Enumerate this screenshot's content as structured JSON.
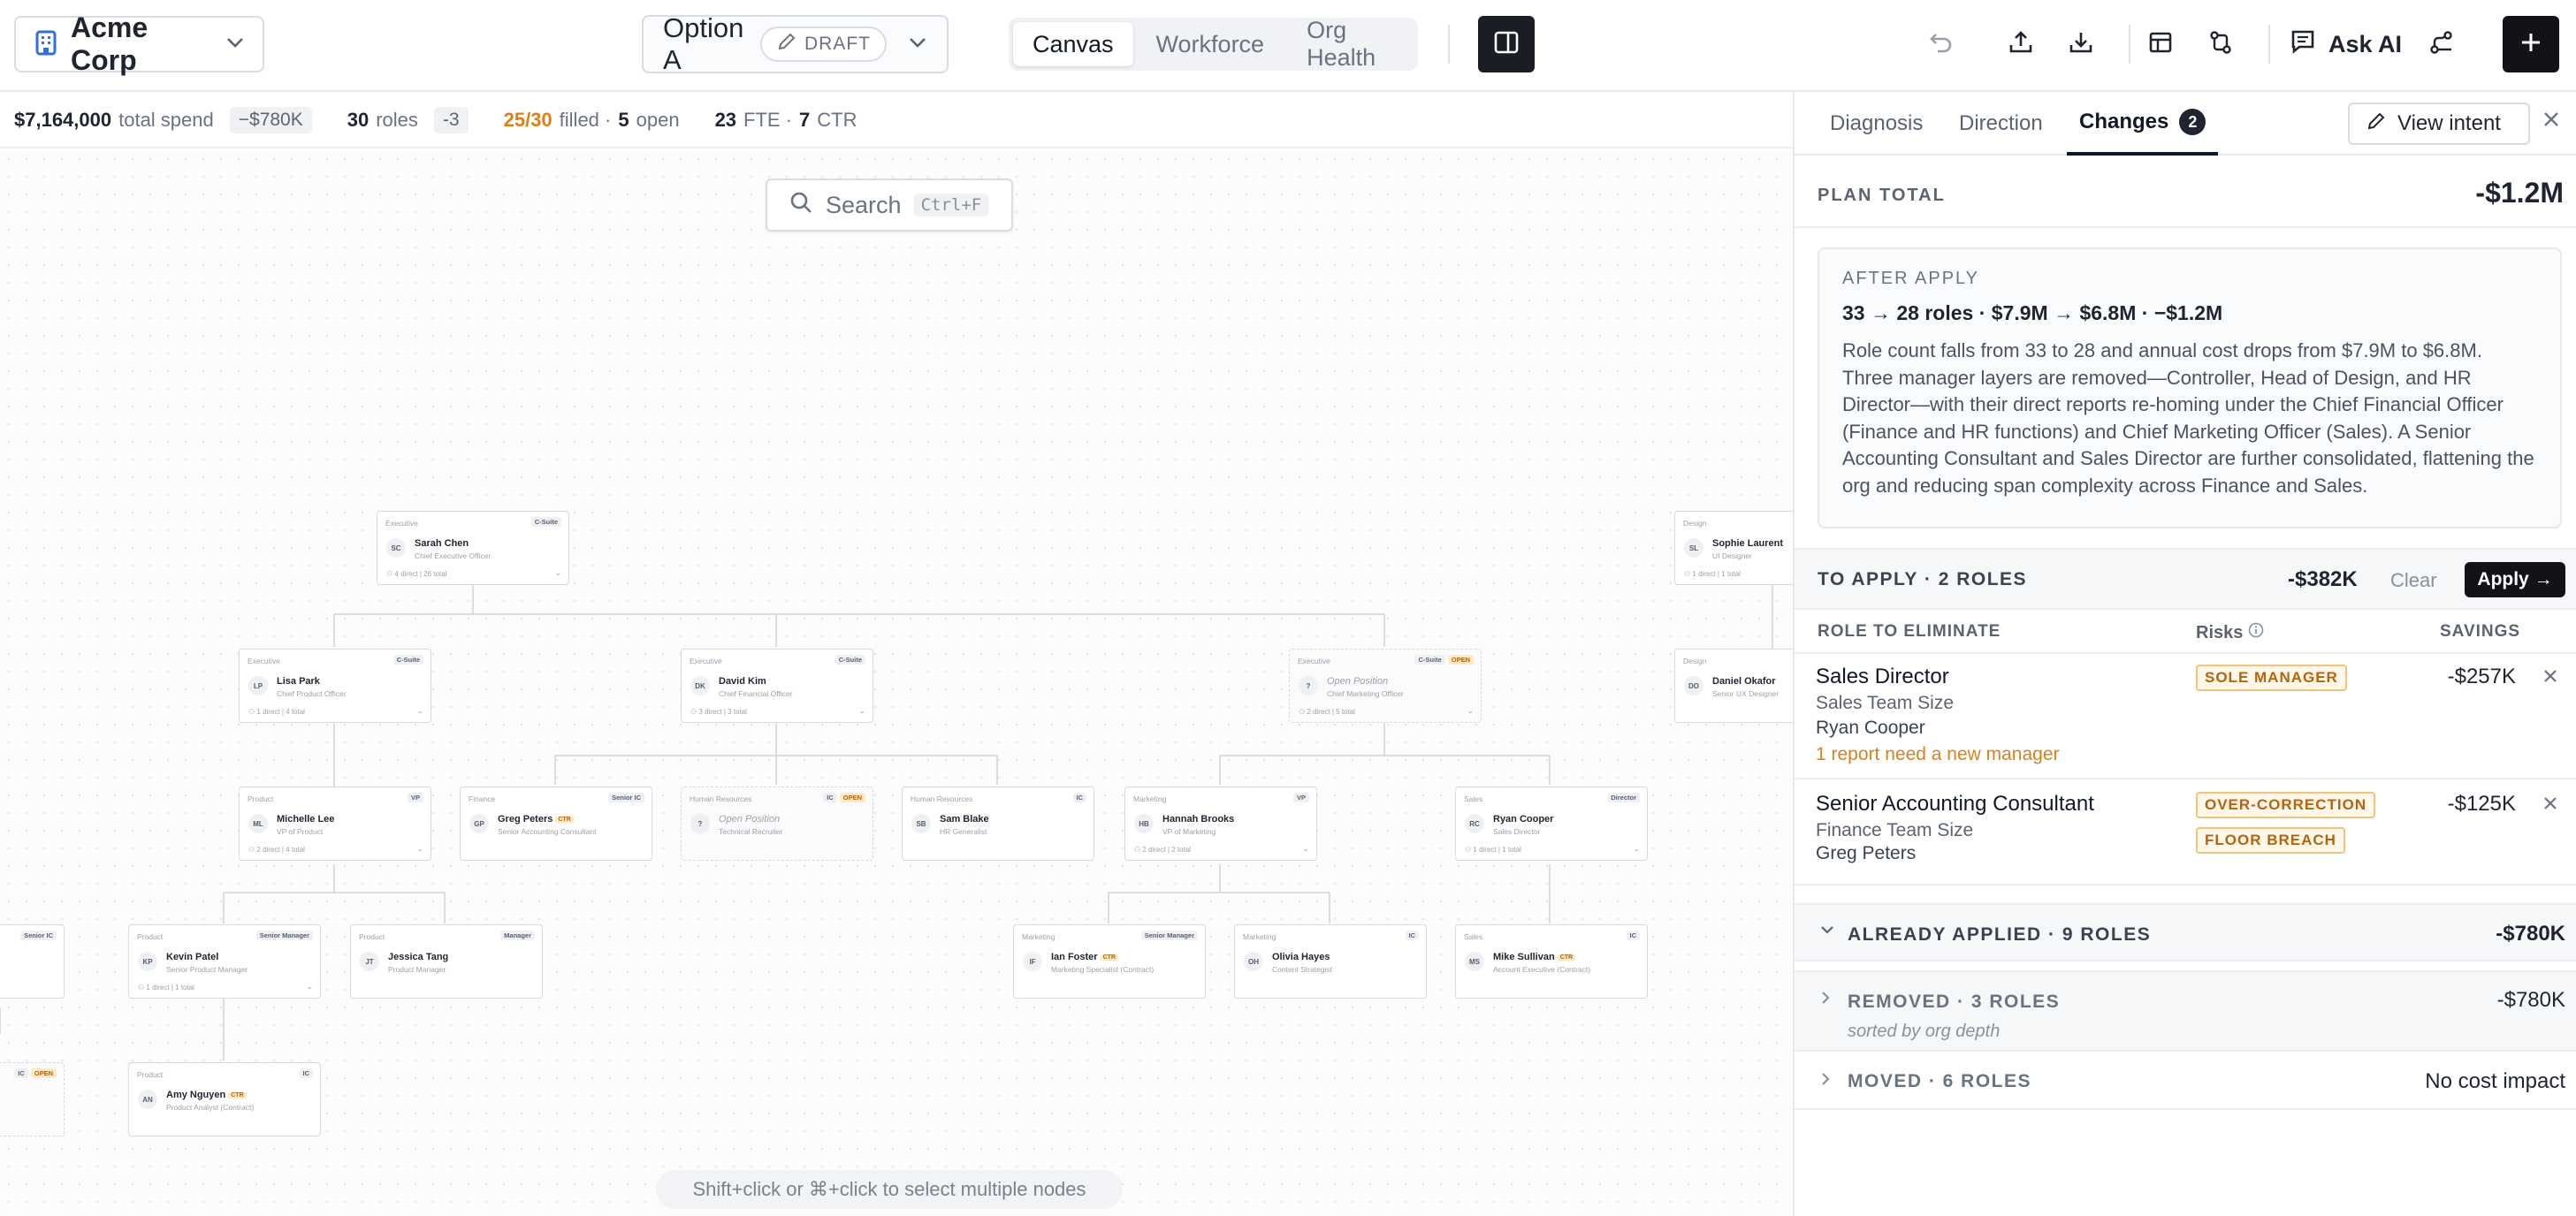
{
  "toolbar": {
    "org_name": "Acme Corp",
    "scenario_name": "Option A",
    "scenario_status": "DRAFT",
    "view_tabs": [
      {
        "label": "Canvas",
        "active": true
      },
      {
        "label": "Workforce",
        "active": false
      },
      {
        "label": "Org Health",
        "active": false
      }
    ],
    "ask_ai_label": "Ask AI",
    "icons": [
      "building-icon",
      "pencil-icon",
      "chevron-down-icon",
      "panel-toggle-icon",
      "undo-icon",
      "upload-icon",
      "download-icon",
      "table-icon",
      "compare-icon",
      "chat-icon",
      "path-icon",
      "plus-icon"
    ]
  },
  "stats": {
    "total_spend": "$7,164,000",
    "total_spend_label": "total spend",
    "spend_delta": "−$780K",
    "roles": "30",
    "roles_label": "roles",
    "roles_delta": "-3",
    "filled": "25/30",
    "filled_label": "filled ·",
    "open": "5",
    "open_label": "open",
    "fte": "23",
    "fte_label": "FTE ·",
    "ctr": "7",
    "ctr_label": "CTR"
  },
  "canvas": {
    "search_placeholder": "Search",
    "search_shortcut": "Ctrl+F",
    "hint": "Shift+click or ⌘+click to select multiple nodes",
    "nodes": [
      {
        "dept": "Executive",
        "tags": [
          "C-Suite"
        ],
        "initials": "SC",
        "name": "Sarah Chen",
        "title": "Chief Executive Officer",
        "reports": "4 direct | 26 total",
        "open": false,
        "ctr": false
      },
      {
        "dept": "Executive",
        "tags": [
          "C-Suite"
        ],
        "initials": "LP",
        "name": "Lisa Park",
        "title": "Chief Product Officer",
        "reports": "1 direct | 4 total",
        "open": false,
        "ctr": false
      },
      {
        "dept": "Executive",
        "tags": [
          "C-Suite"
        ],
        "initials": "DK",
        "name": "David Kim",
        "title": "Chief Financial Officer",
        "reports": "3 direct | 3 total",
        "open": false,
        "ctr": false
      },
      {
        "dept": "Executive",
        "tags": [
          "C-Suite",
          "OPEN"
        ],
        "initials": "?",
        "name": "Open Position",
        "title": "Chief Marketing Officer",
        "reports": "2 direct | 5 total",
        "open": true,
        "ctr": false
      },
      {
        "dept": "Design",
        "tags": [],
        "initials": "SL",
        "name": "Sophie Laurent",
        "title": "UI Designer",
        "reports": "1 direct | 1 total",
        "open": false,
        "ctr": false
      },
      {
        "dept": "Design",
        "tags": [],
        "initials": "DO",
        "name": "Daniel Okafor",
        "title": "Senior UX Designer",
        "reports": "",
        "open": false,
        "ctr": false
      },
      {
        "dept": "Product",
        "tags": [
          "VP"
        ],
        "initials": "ML",
        "name": "Michelle Lee",
        "title": "VP of Product",
        "reports": "2 direct | 4 total",
        "open": false,
        "ctr": false
      },
      {
        "dept": "Finance",
        "tags": [
          "Senior IC"
        ],
        "initials": "GP",
        "name": "Greg Peters",
        "title": "Senior Accounting Consultant",
        "reports": "",
        "open": false,
        "ctr": true
      },
      {
        "dept": "Human Resources",
        "tags": [
          "IC",
          "OPEN"
        ],
        "initials": "?",
        "name": "Open Position",
        "title": "Technical Recruiter",
        "reports": "",
        "open": true,
        "ctr": false
      },
      {
        "dept": "Human Resources",
        "tags": [
          "IC"
        ],
        "initials": "SB",
        "name": "Sam Blake",
        "title": "HR Generalist",
        "reports": "",
        "open": false,
        "ctr": false
      },
      {
        "dept": "Marketing",
        "tags": [
          "VP"
        ],
        "initials": "HB",
        "name": "Hannah Brooks",
        "title": "VP of Marketing",
        "reports": "2 direct | 2 total",
        "open": false,
        "ctr": false
      },
      {
        "dept": "Sales",
        "tags": [
          "Director"
        ],
        "initials": "RC",
        "name": "Ryan Cooper",
        "title": "Sales Director",
        "reports": "1 direct | 1 total",
        "open": false,
        "ctr": false
      },
      {
        "dept": "",
        "tags": [
          "Senior IC"
        ],
        "initials": "",
        "name": "nez",
        "title": "ultant",
        "reports": "",
        "open": false,
        "ctr": true
      },
      {
        "dept": "Product",
        "tags": [
          "Senior Manager"
        ],
        "initials": "KP",
        "name": "Kevin Patel",
        "title": "Senior Product Manager",
        "reports": "1 direct | 1 total",
        "open": false,
        "ctr": false
      },
      {
        "dept": "Product",
        "tags": [
          "Manager"
        ],
        "initials": "JT",
        "name": "Jessica Tang",
        "title": "Product Manager",
        "reports": "",
        "open": false,
        "ctr": false
      },
      {
        "dept": "Marketing",
        "tags": [
          "Senior Manager"
        ],
        "initials": "IF",
        "name": "Ian Foster",
        "title": "Marketing Specialist (Contract)",
        "reports": "",
        "open": false,
        "ctr": true
      },
      {
        "dept": "Marketing",
        "tags": [
          "IC"
        ],
        "initials": "OH",
        "name": "Olivia Hayes",
        "title": "Content Strategist",
        "reports": "",
        "open": false,
        "ctr": false
      },
      {
        "dept": "Sales",
        "tags": [
          "IC"
        ],
        "initials": "MS",
        "name": "Mike Sullivan",
        "title": "Account Executive (Contract)",
        "reports": "",
        "open": false,
        "ctr": true
      },
      {
        "dept": "",
        "tags": [
          "IC",
          "OPEN"
        ],
        "initials": "",
        "name": "ion",
        "title": "ewer",
        "reports": "",
        "open": true,
        "ctr": false
      },
      {
        "dept": "Product",
        "tags": [
          "IC"
        ],
        "initials": "AN",
        "name": "Amy Nguyen",
        "title": "Product Analyst (Contract)",
        "reports": "",
        "open": false,
        "ctr": true
      }
    ]
  },
  "panel": {
    "tabs": [
      {
        "label": "Diagnosis",
        "active": false
      },
      {
        "label": "Direction",
        "active": false
      },
      {
        "label": "Changes",
        "active": true,
        "badge": "2"
      }
    ],
    "view_intent_label": "View intent",
    "plan_total_label": "PLAN TOTAL",
    "plan_total_value": "-$1.2M",
    "after_apply": {
      "label": "AFTER APPLY",
      "summary": "33 → 28 roles · $7.9M → $6.8M · −$1.2M",
      "description": "Role count falls from 33 to 28 and annual cost drops from $7.9M to $6.8M. Three manager layers are removed—Controller, Head of Design, and HR Director—with their direct reports re-homing under the Chief Financial Officer (Finance and HR functions) and Chief Marketing Officer (Sales). A Senior Accounting Consultant and Sales Director are further consolidated, flattening the org and reducing span complexity across Finance and Sales."
    },
    "to_apply": {
      "label": "TO APPLY · 2 ROLES",
      "amount": "-$382K",
      "clear_label": "Clear",
      "apply_label": "Apply →"
    },
    "columns": {
      "role": "ROLE TO ELIMINATE",
      "risks": "Risks",
      "savings": "SAVINGS"
    },
    "rows": [
      {
        "name": "Sales Director",
        "team": "Sales Team Size",
        "person": "Ryan Cooper",
        "warning": "1 report need a new manager",
        "risks": [
          "SOLE MANAGER"
        ],
        "saving": "-$257K"
      },
      {
        "name": "Senior Accounting Consultant",
        "team": "Finance Team Size",
        "person": "Greg Peters",
        "warning": "",
        "risks": [
          "OVER-CORRECTION",
          "FLOOR BREACH"
        ],
        "saving": "-$125K"
      }
    ],
    "already_applied": {
      "label": "ALREADY APPLIED · 9 ROLES",
      "amount": "-$780K"
    },
    "removed": {
      "label": "REMOVED · 3 ROLES",
      "sub": "sorted by org depth",
      "amount": "-$780K"
    },
    "moved": {
      "label": "MOVED · 6 ROLES",
      "amount": "No cost impact"
    }
  }
}
